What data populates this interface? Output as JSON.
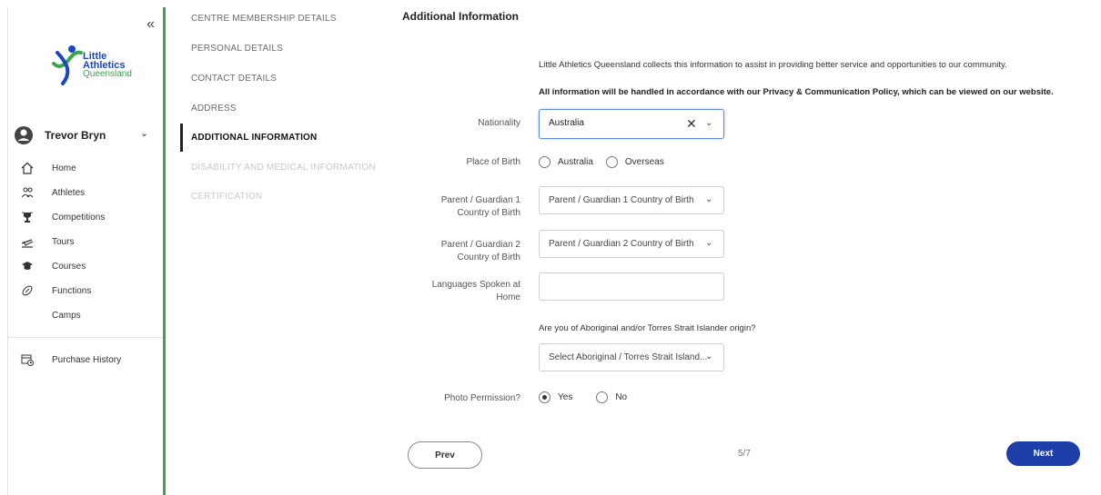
{
  "sidebar": {
    "collapse_glyph": "«",
    "logo": {
      "line1": "Little",
      "line2": "Athletics",
      "line3": "Queensland"
    },
    "user_name": "Trevor Bryn",
    "nav": [
      {
        "label": "Home",
        "icon": "home-icon"
      },
      {
        "label": "Athletes",
        "icon": "people-icon"
      },
      {
        "label": "Competitions",
        "icon": "trophy-icon"
      },
      {
        "label": "Tours",
        "icon": "plane-icon"
      },
      {
        "label": "Courses",
        "icon": "graduation-cap-icon"
      },
      {
        "label": "Functions",
        "icon": "football-icon"
      },
      {
        "label": "Camps",
        "icon": ""
      }
    ],
    "purchase_history": "Purchase History"
  },
  "steps": [
    {
      "label": "CENTRE MEMBERSHIP DETAILS",
      "state": "done"
    },
    {
      "label": "PERSONAL DETAILS",
      "state": "done"
    },
    {
      "label": "CONTACT DETAILS",
      "state": "done"
    },
    {
      "label": "ADDRESS",
      "state": "done"
    },
    {
      "label": "ADDITIONAL INFORMATION",
      "state": "active"
    },
    {
      "label": "DISABILITY AND MEDICAL INFORMATION",
      "state": "todo"
    },
    {
      "label": "CERTIFICATION",
      "state": "todo"
    }
  ],
  "main": {
    "title": "Additional Information",
    "info1": "Little Athletics Queensland collects this information to assist in providing better service and opportunities to our community.",
    "info2": "All information will be handled in accordance with our Privacy & Communication Policy, which can be viewed on our website.",
    "nationality_label": "Nationality",
    "nationality_value": "Australia",
    "place_of_birth_label": "Place of Birth",
    "place_of_birth_options": [
      "Australia",
      "Overseas"
    ],
    "guardian1_label_1": "Parent / Guardian 1",
    "guardian1_label_2": "Country of Birth",
    "guardian1_placeholder": "Parent / Guardian 1 Country of Birth",
    "guardian2_label_1": "Parent / Guardian 2",
    "guardian2_label_2": "Country of Birth",
    "guardian2_placeholder": "Parent / Guardian 2 Country of Birth",
    "languages_label_1": "Languages Spoken at",
    "languages_label_2": "Home",
    "languages_value": "",
    "aboriginal_question": "Are you of Aboriginal and/or Torres Strait Islander origin?",
    "aboriginal_placeholder": "Select Aboriginal / Torres Strait Island...",
    "photo_label": "Photo Permission?",
    "photo_options": [
      "Yes",
      "No"
    ],
    "photo_selected": "Yes",
    "prev_label": "Prev",
    "page_count": "5/7",
    "next_label": "Next"
  },
  "colors": {
    "accent_green": "#3aa54a",
    "brand_blue": "#1f3fa8",
    "focus_blue": "#5e8bd3"
  }
}
